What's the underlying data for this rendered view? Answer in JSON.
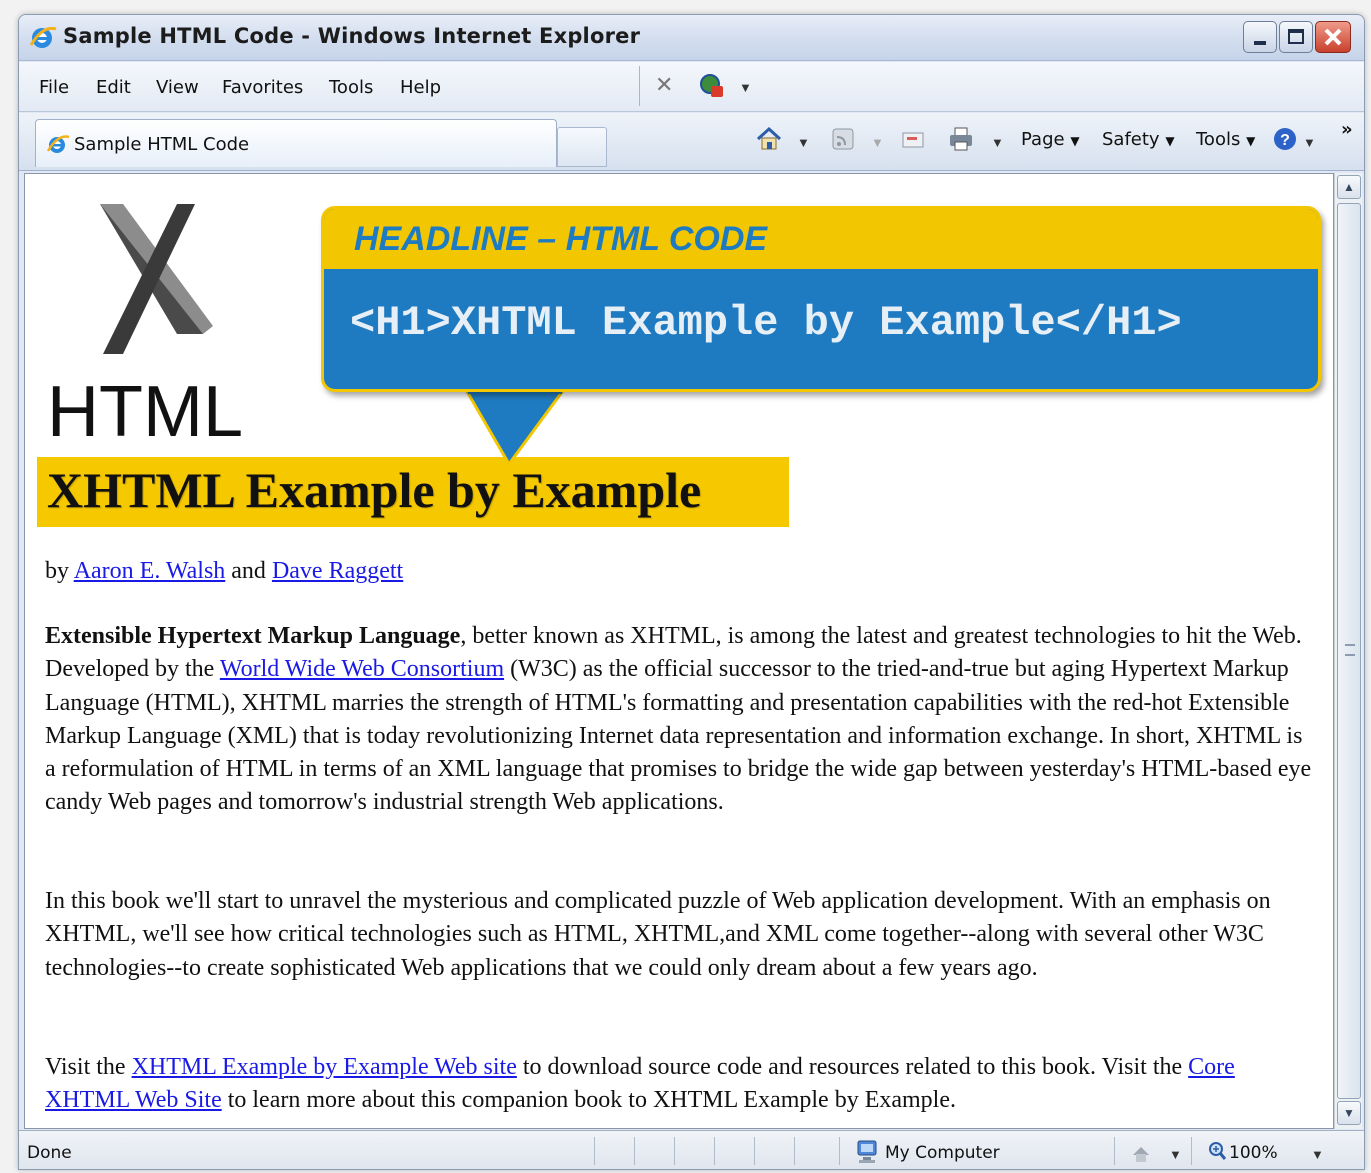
{
  "window": {
    "title": "Sample HTML Code - Windows Internet Explorer"
  },
  "menubar": {
    "items": [
      "File",
      "Edit",
      "View",
      "Favorites",
      "Tools",
      "Help"
    ]
  },
  "tabs": {
    "active_label": "Sample HTML Code"
  },
  "command_bar": {
    "page_label": "Page",
    "safety_label": "Safety",
    "tools_label": "Tools",
    "overflow_glyph": "»"
  },
  "callout": {
    "title": "HEADLINE – HTML CODE",
    "code": "<H1>XHTML Example by Example</H1>"
  },
  "logo": {
    "letter": "X",
    "word": "HTML"
  },
  "page": {
    "heading": "XHTML Example by Example",
    "byline": {
      "prefix": "by ",
      "author1": "Aaron E. Walsh",
      "and": " and ",
      "author2": "Dave Raggett"
    },
    "p1": {
      "bold": "Extensible Hypertext Markup Language",
      "text1": ", better known as XHTML, is among the latest and greatest technologies to hit the Web. Developed by the ",
      "link": "World Wide Web Consortium",
      "text2": " (W3C) as the official successor to the tried-and-true but aging Hypertext Markup Language (HTML), XHTML marries the strength of HTML's formatting and presentation capabilities with the red-hot Extensible Markup Language (XML) that is today revolutionizing Internet data representation and information exchange. In short, XHTML is a reformulation of HTML in terms of an XML language that promises to bridge the wide gap between yesterday's HTML-based eye candy Web pages and tomorrow's industrial strength Web applications."
    },
    "p2": "In this book we'll start to unravel the mysterious and complicated puzzle of Web application development. With an emphasis on XHTML, we'll see how critical technologies such as HTML, XHTML,and XML come together--along with several other W3C technologies--to create sophisticated Web applications that we could only dream about a few years ago.",
    "p3": {
      "text1": "Visit the ",
      "link1": "XHTML Example by Example Web site",
      "text2": " to download source code and resources related to this book. Visit the ",
      "link2": "Core XHTML Web Site",
      "text3": " to learn more about this companion book to XHTML Example by Example."
    }
  },
  "status": {
    "text": "Done",
    "zone": "My Computer",
    "zoom": "100%"
  },
  "colors": {
    "callout_blue": "#1f7bc1",
    "highlight_yellow": "#f5c800",
    "link_blue": "#1a1ae6"
  }
}
